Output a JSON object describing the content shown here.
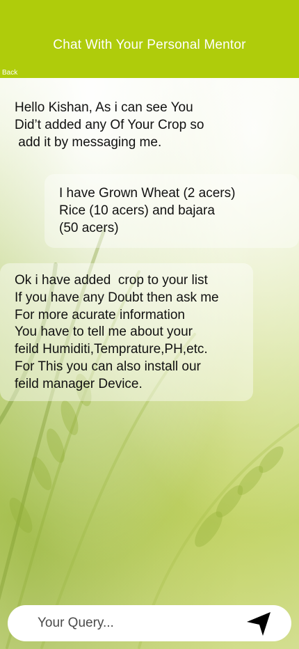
{
  "header": {
    "title": "Chat With Your Personal Mentor",
    "back_label": "Back",
    "color": "#afcc0b"
  },
  "messages": [
    {
      "sender": "mentor",
      "text": "Hello Kishan, As i can see You\nDid’t added any Of Your Crop so\n add it by messaging me."
    },
    {
      "sender": "user",
      "text": "I have Grown Wheat (2 acers)\nRice (10 acers) and bajara\n(50 acers)"
    },
    {
      "sender": "mentor",
      "text": "Ok i have added  crop to your list\nIf you have any Doubt then ask me\nFor more acurate information\nYou have to tell me about your\nfeild Humiditi,Temprature,PH,etc.\nFor This you can also install our\nfeild manager Device."
    }
  ],
  "composer": {
    "placeholder": "Your Query...",
    "value": "",
    "send_icon": "send-arrow-icon"
  }
}
